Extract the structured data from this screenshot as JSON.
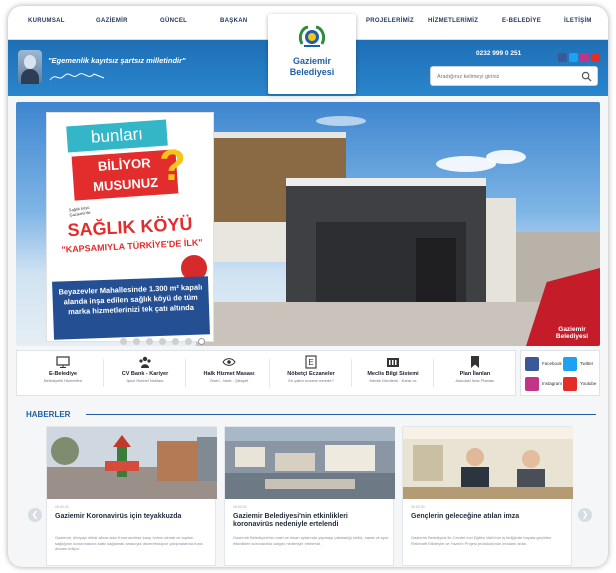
{
  "nav": {
    "items": [
      "KURUMSAL",
      "GAZİEMİR",
      "GÜNCEL",
      "BAŞKAN",
      "PROJELERİMİZ",
      "HİZMETLERİMİZ",
      "E-BELEDİYE",
      "İLETİŞİM"
    ]
  },
  "header": {
    "quote": "\"Egemenlik kayıtsız şartsız milletindir\"",
    "phone": "0232 999 0 251",
    "search_placeholder": "Aradığınız kelimeyi giriniz",
    "social_colors": [
      "#3b5998",
      "#1da1f2",
      "#c13584",
      "#e52d27"
    ]
  },
  "logo": {
    "line1": "Gaziemir",
    "line2": "Belediyesi"
  },
  "hero": {
    "bunlari": "bunları",
    "biliyor_1": "BİLİYOR",
    "biliyor_2": "MUSUNUZ",
    "qmark": "?",
    "note": "Sağlık köyü Gaziemir'de",
    "saglik": "SAĞLIK KÖYÜ",
    "kapsam": "\"KAPSAMIYLA TÜRKİYE'DE İLK\"",
    "body": "Beyazevler Mahallesinde 1.300 m² kapalı alanda inşa edilen sağlık köyü de tüm marka hizmetlerinizi tek çatı altında",
    "corner_1": "Gaziemir",
    "corner_2": "Belediyesi",
    "slide_count": 7,
    "active_slide": 7
  },
  "services": [
    {
      "title": "E-Belediye",
      "sub": "Belediyelik Hizmetleri",
      "icon": "monitor-icon"
    },
    {
      "title": "CV Bank - Kariyer",
      "sub": "İşkur Hizmet Noktası",
      "icon": "people-icon"
    },
    {
      "title": "Halk Hizmet Masası",
      "sub": "Öneri - İstek - Şikayet",
      "icon": "eye-icon"
    },
    {
      "title": "Nöbetçi Eczaneler",
      "sub": "En yakın eczane nerede?",
      "icon": "pharmacy-icon"
    },
    {
      "title": "Meclis Bilgi Sistemi",
      "sub": "Meclis Gündemi - Karar vs",
      "icon": "building-icon"
    },
    {
      "title": "Plan İlanları",
      "sub": "Askıdaki İmar Planları",
      "icon": "bookmark-icon"
    }
  ],
  "social": [
    {
      "label": "Facebook",
      "color": "#3b5998",
      "icon": "facebook-icon"
    },
    {
      "label": "Twitter",
      "color": "#1da1f2",
      "icon": "twitter-icon"
    },
    {
      "label": "Instagram",
      "color": "#c13584",
      "icon": "instagram-icon"
    },
    {
      "label": "Youtube",
      "color": "#e52d27",
      "icon": "youtube-icon"
    }
  ],
  "news": {
    "heading": "HABERLER",
    "cards": [
      {
        "date": "26.03.20",
        "title": "Gaziemir Koronavirüs için teyakkuzda",
        "text": "Gaziemir, dünyayı etkisi altına alan Koronavirüse karşı önlem almak ve toplum sağlığının korunmasına katkı sağlamak amacıyla dezenfeksiyon çalışmalarına hızla devam ediyor."
      },
      {
        "date": "26.03.20",
        "title": "Gaziemir Belediyesi'nin etkinlikleri koronavirüs nedeniyle ertelendi",
        "text": "Gaziemir Belediyesi'nin mart ve nisan aylarında yapmayı planladığı kültür, sanat ve spor etkinlikleri koronavirüs salgını nedeniyle ertelendi."
      },
      {
        "date": "26.03.20",
        "title": "Gençlerin geleceğine atılan imza",
        "text": "Gaziemir Belediyesi ile Cevdet İnci Eğitim Vakfı'nın iş birliğinde hayata geçirilen Rekreatif Etkileşim ve Yazılım Projesi protokolünün imzaları atıldı."
      }
    ]
  }
}
